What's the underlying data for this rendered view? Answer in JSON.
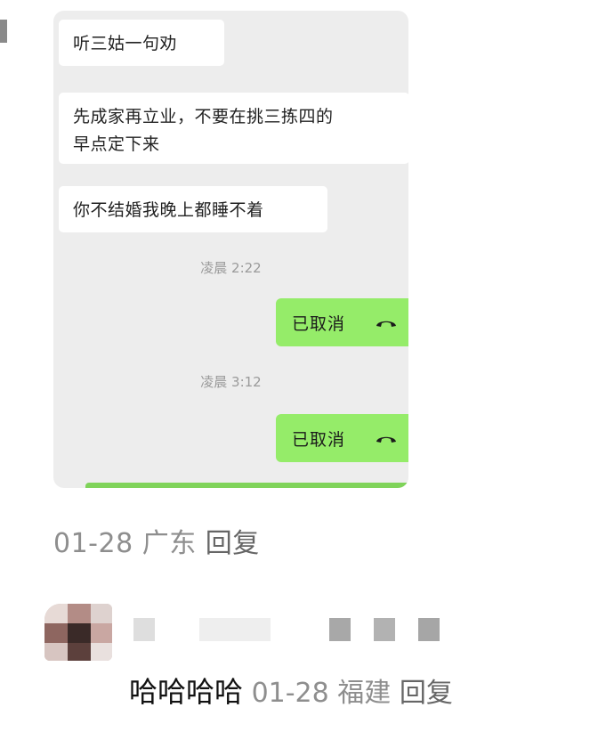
{
  "chat_screenshot": {
    "messages": [
      {
        "text": "听三姑一句劝"
      },
      {
        "text": "先成家再立业，不要在挑三拣四的\n早点定下来"
      },
      {
        "text": "你不结婚我晚上都睡不着"
      }
    ],
    "calls": [
      {
        "time": "凌晨 2:22",
        "label": "已取消",
        "icon": "phone-hangup-icon"
      },
      {
        "time": "凌晨 3:12",
        "label": "已取消",
        "icon": "phone-hangup-icon"
      }
    ]
  },
  "post_meta": {
    "date": "01-28",
    "location": "广东",
    "reply": "回复"
  },
  "comment": {
    "text": "哈哈哈哈",
    "date": "01-28",
    "location": "福建",
    "reply": "回复",
    "colors": {
      "bubble_green": "#95ec69",
      "chat_bg": "#ededed",
      "meta_gray": "#8e8e8e"
    }
  }
}
